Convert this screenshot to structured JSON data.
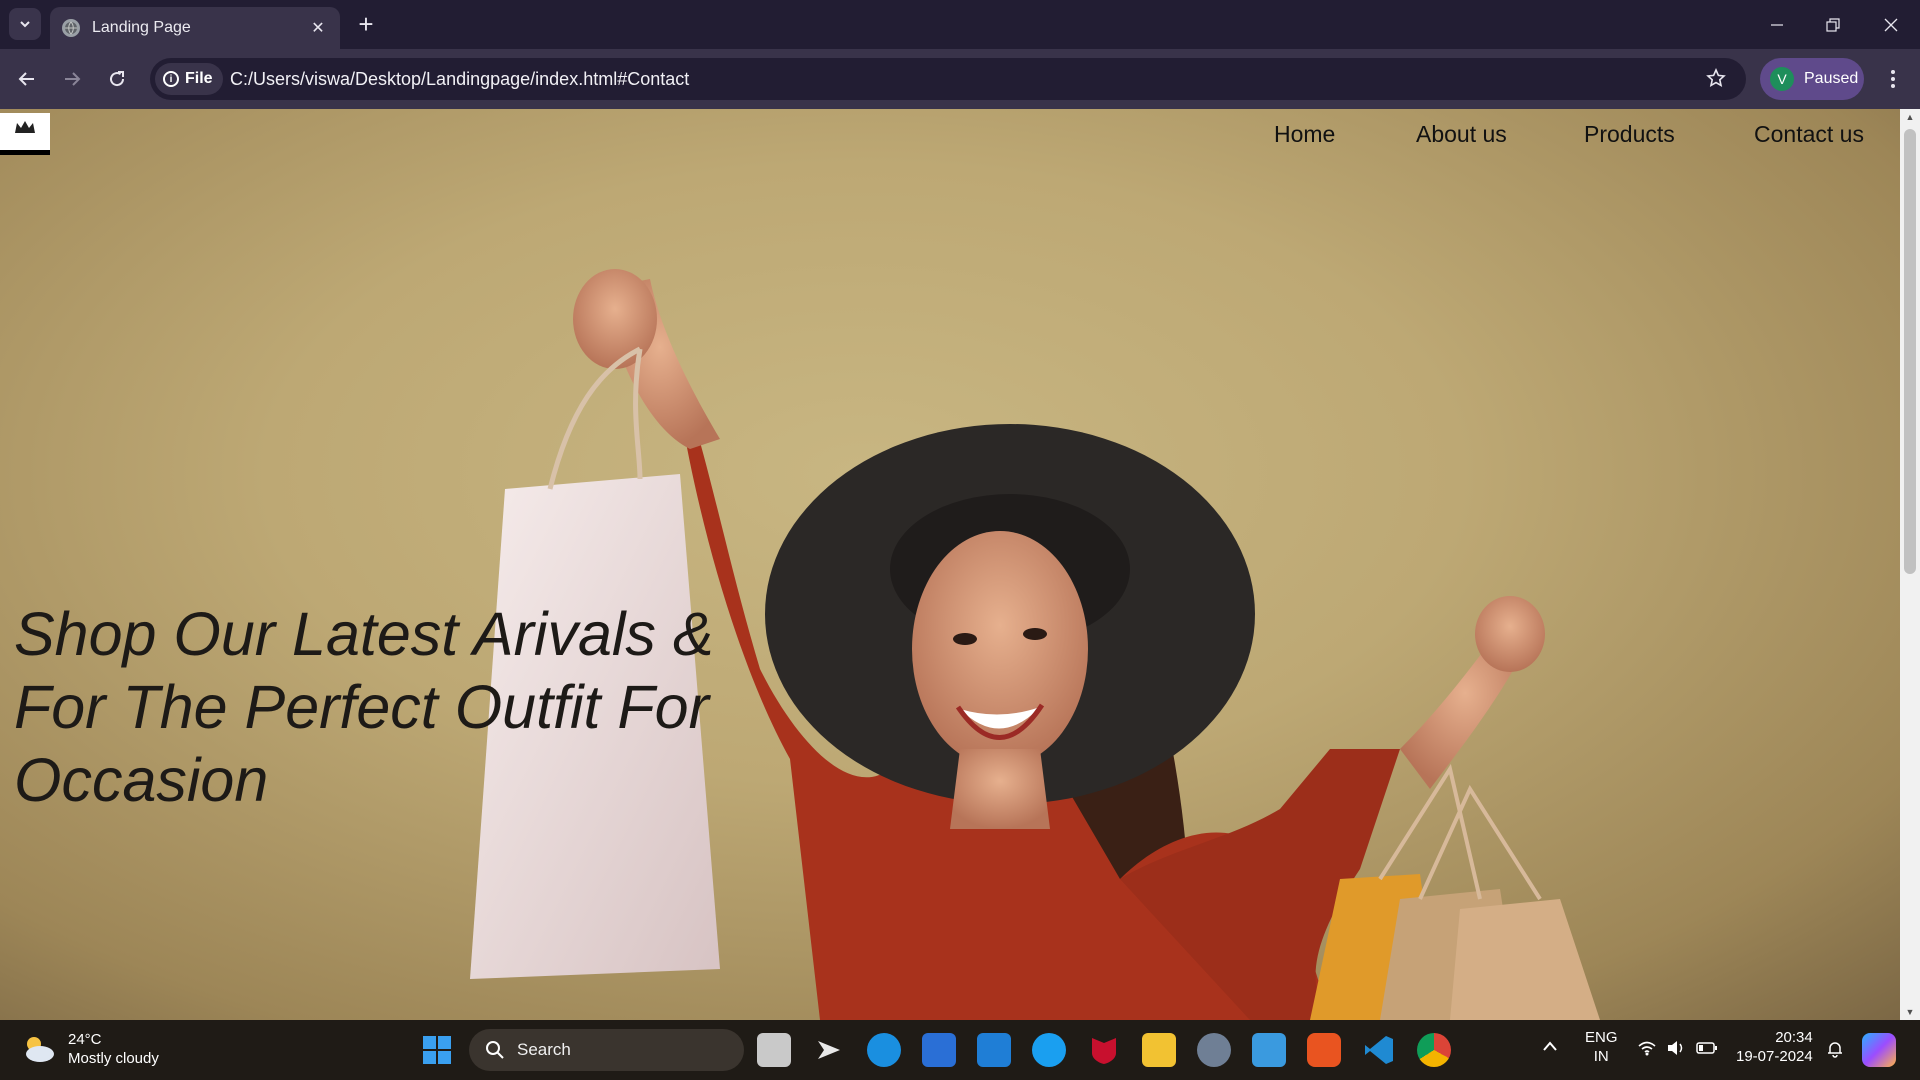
{
  "browser": {
    "tab_title": "Landing Page",
    "url_chip": "File",
    "url": "C:/Users/viswa/Desktop/Landingpage/index.html#Contact",
    "profile_initial": "V",
    "profile_status": "Paused"
  },
  "page": {
    "nav": {
      "home": "Home",
      "about": "About us",
      "products": "Products",
      "contact": "Contact us"
    },
    "hero_line1": "Shop Our Latest Arivals &",
    "hero_line2": "For The Perfect Outfit For",
    "hero_line3": "Occasion"
  },
  "taskbar": {
    "weather_temp": "24°C",
    "weather_desc": "Mostly cloudy",
    "search_placeholder": "Search",
    "lang_top": "ENG",
    "lang_bottom": "IN",
    "time": "20:34",
    "date": "19-07-2024"
  }
}
